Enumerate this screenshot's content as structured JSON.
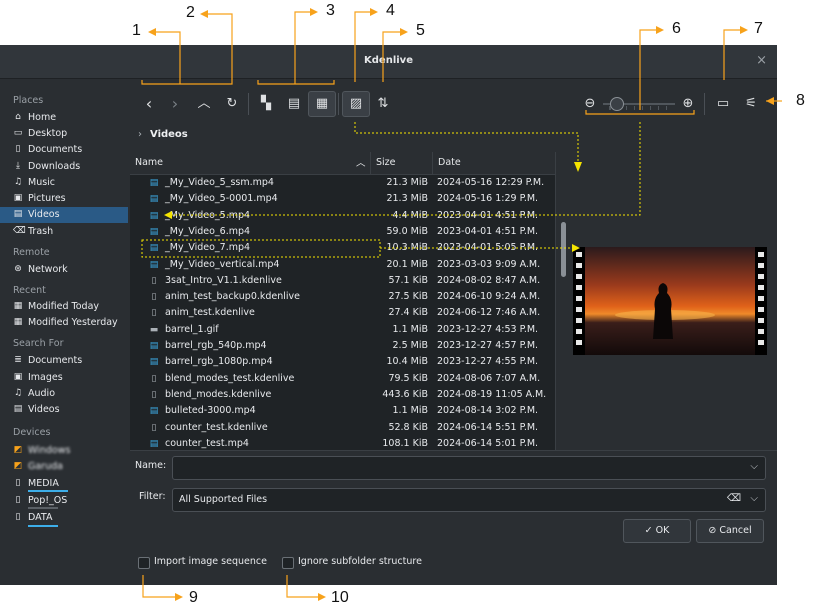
{
  "window": {
    "title": "Kdenlive",
    "close_glyph": "×"
  },
  "sidebar": {
    "places_header": "Places",
    "places": [
      {
        "label": "Home",
        "icon": "home-icon",
        "glyph": "⌂"
      },
      {
        "label": "Desktop",
        "icon": "desktop-icon",
        "glyph": "▭"
      },
      {
        "label": "Documents",
        "icon": "documents-icon",
        "glyph": "▯"
      },
      {
        "label": "Downloads",
        "icon": "downloads-icon",
        "glyph": "⤓"
      },
      {
        "label": "Music",
        "icon": "music-icon",
        "glyph": "♫"
      },
      {
        "label": "Pictures",
        "icon": "pictures-icon",
        "glyph": "▣"
      },
      {
        "label": "Videos",
        "icon": "videos-icon",
        "glyph": "▤",
        "selected": true
      },
      {
        "label": "Trash",
        "icon": "trash-icon",
        "glyph": "⌫"
      }
    ],
    "remote_header": "Remote",
    "remote": [
      {
        "label": "Network",
        "icon": "network-icon",
        "glyph": "⊛"
      }
    ],
    "recent_header": "Recent",
    "recent": [
      {
        "label": "Modified Today",
        "icon": "calendar-icon",
        "glyph": "▦"
      },
      {
        "label": "Modified Yesterday",
        "icon": "calendar-icon",
        "glyph": "▦"
      }
    ],
    "search_header": "Search For",
    "search": [
      {
        "label": "Documents",
        "icon": "documents-icon",
        "glyph": "≣"
      },
      {
        "label": "Images",
        "icon": "images-icon",
        "glyph": "▣"
      },
      {
        "label": "Audio",
        "icon": "audio-icon",
        "glyph": "♫"
      },
      {
        "label": "Videos",
        "icon": "videos-icon",
        "glyph": "▤"
      }
    ],
    "devices_header": "Devices",
    "devices": [
      {
        "label": "Windows",
        "icon": "drive-icon",
        "glyph": "◩",
        "blurred": true
      },
      {
        "label": "Garuda",
        "icon": "drive-icon",
        "glyph": "◩",
        "blurred": true
      },
      {
        "label": "MEDIA",
        "icon": "drive-icon",
        "glyph": "▯",
        "usage": 0.25
      },
      {
        "label": "Pop!_OS",
        "icon": "drive-icon",
        "glyph": "▯",
        "usage": 0.45
      },
      {
        "label": "DATA",
        "icon": "drive-icon",
        "glyph": "▯",
        "usage": 0.3
      }
    ]
  },
  "toolbar": {
    "back": "‹",
    "forward": "›",
    "up": "︿",
    "reload": "↻",
    "view_icons": "▚",
    "view_compact": "▤",
    "view_detail": "▦",
    "preview": "▨",
    "sort": "⇅",
    "new_folder": "▭",
    "options": "⚟",
    "zoom_out": "⊖",
    "zoom_in": "⊕",
    "zoom_level": 0.12
  },
  "breadcrumb": {
    "chevron": "›",
    "folder": "Videos"
  },
  "columns": {
    "name": "Name",
    "size": "Size",
    "date": "Date",
    "sort_glyph": "︿"
  },
  "files": [
    {
      "name": "_My_Video_5_ssm.mp4",
      "size": "21.3 MiB",
      "date": "2024-05-16 12:29 P.M.",
      "type": "video"
    },
    {
      "name": "_My_Video_5-0001.mp4",
      "size": "21.3 MiB",
      "date": "2024-05-16 1:29 P.M.",
      "type": "video"
    },
    {
      "name": "_My_Video_5.mp4",
      "size": "4.4 MiB",
      "date": "2023-04-01 4:51 P.M.",
      "type": "video"
    },
    {
      "name": "_My_Video_6.mp4",
      "size": "59.0 MiB",
      "date": "2023-04-01 4:51 P.M.",
      "type": "video"
    },
    {
      "name": "_My_Video_7.mp4",
      "size": "10.3 MiB",
      "date": "2023-04-01 5:05 P.M.",
      "type": "video"
    },
    {
      "name": "_My_Video_vertical.mp4",
      "size": "20.1 MiB",
      "date": "2023-03-03 9:09 A.M.",
      "type": "video"
    },
    {
      "name": "3sat_Intro_V1.1.kdenlive",
      "size": "57.1 KiB",
      "date": "2024-08-02 8:47 A.M.",
      "type": "doc"
    },
    {
      "name": "anim_test_backup0.kdenlive",
      "size": "27.5 KiB",
      "date": "2024-06-10 9:24 A.M.",
      "type": "doc"
    },
    {
      "name": "anim_test.kdenlive",
      "size": "27.4 KiB",
      "date": "2024-06-12 7:46 A.M.",
      "type": "doc"
    },
    {
      "name": "barrel_1.gif",
      "size": "1.1 MiB",
      "date": "2023-12-27 4:53 P.M.",
      "type": "gif"
    },
    {
      "name": "barrel_rgb_540p.mp4",
      "size": "2.5 MiB",
      "date": "2023-12-27 4:57 P.M.",
      "type": "video"
    },
    {
      "name": "barrel_rgb_1080p.mp4",
      "size": "10.4 MiB",
      "date": "2023-12-27 4:55 P.M.",
      "type": "video"
    },
    {
      "name": "blend_modes_test.kdenlive",
      "size": "79.5 KiB",
      "date": "2024-08-06 7:07 A.M.",
      "type": "doc"
    },
    {
      "name": "blend_modes.kdenlive",
      "size": "443.6 KiB",
      "date": "2024-08-19 11:05 A.M.",
      "type": "doc"
    },
    {
      "name": "bulleted-3000.mp4",
      "size": "1.1 MiB",
      "date": "2024-08-14 3:02 P.M.",
      "type": "video"
    },
    {
      "name": "counter_test.kdenlive",
      "size": "52.8 KiB",
      "date": "2024-06-14 5:51 P.M.",
      "type": "doc"
    },
    {
      "name": "counter_test.mp4",
      "size": "108.1 KiB",
      "date": "2024-06-14 5:01 P.M.",
      "type": "video"
    }
  ],
  "form": {
    "name_label": "Name:",
    "name_value": "",
    "dropdown_glyph": "⌵",
    "filter_label": "Filter:",
    "filter_value": "All Supported Files",
    "clear_glyph": "⌫"
  },
  "buttons": {
    "ok": "OK",
    "ok_glyph": "✓",
    "cancel": "Cancel",
    "cancel_glyph": "⊘"
  },
  "checkboxes": {
    "import_sequence": "Import image sequence",
    "ignore_subfolder": "Ignore subfolder structure"
  },
  "callouts": [
    "1",
    "2",
    "3",
    "4",
    "5",
    "6",
    "7",
    "8",
    "9",
    "10"
  ],
  "colors": {
    "accent": "#3daee9",
    "callout": "#f7a21b",
    "yellow": "#f5e400",
    "selection": "#2a5a86"
  }
}
